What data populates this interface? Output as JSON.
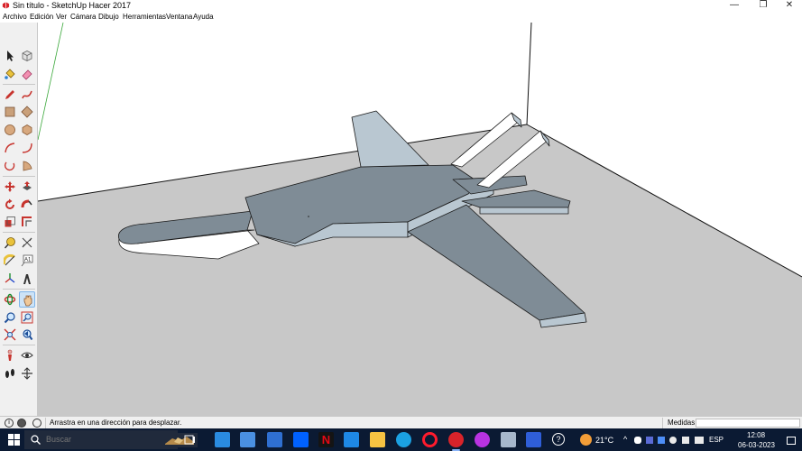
{
  "window": {
    "title": "Sin título - SketchUp Hacer 2017",
    "app_icon": "sketchup-logo-icon",
    "controls": [
      "minimize-icon",
      "maximize-icon",
      "close-icon"
    ],
    "minimize_glyph": "—",
    "maximize_glyph": "❐",
    "close_glyph": "✕"
  },
  "menubar": {
    "items": [
      "Archivo",
      "Edición",
      "Ver",
      "Cámara",
      "Dibujo",
      "Herramientas",
      "Ventana",
      "Ayuda"
    ]
  },
  "toolbar": {
    "tools": [
      {
        "name": "select-tool",
        "icon": "arrow-cursor-icon"
      },
      {
        "name": "make-component-tool",
        "icon": "component-icon"
      },
      {
        "name": "paint-bucket-tool",
        "icon": "paint-bucket-icon"
      },
      {
        "name": "eraser-tool",
        "icon": "eraser-icon"
      },
      {
        "name": "line-tool",
        "icon": "pencil-icon"
      },
      {
        "name": "freehand-tool",
        "icon": "freehand-icon"
      },
      {
        "name": "rectangle-tool",
        "icon": "rectangle-icon"
      },
      {
        "name": "rotated-rectangle-tool",
        "icon": "rotated-rectangle-icon"
      },
      {
        "name": "circle-tool",
        "icon": "circle-icon"
      },
      {
        "name": "polygon-tool",
        "icon": "polygon-icon"
      },
      {
        "name": "arc-tool",
        "icon": "arc-icon"
      },
      {
        "name": "two-point-arc-tool",
        "icon": "two-point-arc-icon"
      },
      {
        "name": "three-point-arc-tool",
        "icon": "three-point-arc-icon"
      },
      {
        "name": "pie-tool",
        "icon": "pie-icon"
      },
      {
        "name": "move-tool",
        "icon": "move-arrows-icon"
      },
      {
        "name": "push-pull-tool",
        "icon": "push-pull-icon"
      },
      {
        "name": "rotate-tool",
        "icon": "rotate-icon"
      },
      {
        "name": "follow-me-tool",
        "icon": "follow-me-icon"
      },
      {
        "name": "scale-tool",
        "icon": "scale-icon"
      },
      {
        "name": "offset-tool",
        "icon": "offset-icon"
      },
      {
        "name": "tape-measure-tool",
        "icon": "tape-measure-icon"
      },
      {
        "name": "dimension-tool",
        "icon": "dimension-icon"
      },
      {
        "name": "protractor-tool",
        "icon": "protractor-icon"
      },
      {
        "name": "text-tool",
        "icon": "text-icon",
        "glyph": "A1"
      },
      {
        "name": "axes-tool",
        "icon": "axes-icon"
      },
      {
        "name": "3d-text-tool",
        "icon": "3d-text-icon"
      },
      {
        "name": "orbit-tool",
        "icon": "orbit-icon"
      },
      {
        "name": "pan-tool",
        "icon": "pan-hand-icon",
        "active": true
      },
      {
        "name": "zoom-tool",
        "icon": "magnifier-icon"
      },
      {
        "name": "zoom-window-tool",
        "icon": "zoom-window-icon"
      },
      {
        "name": "zoom-extents-tool",
        "icon": "zoom-extents-icon"
      },
      {
        "name": "previous-view-tool",
        "icon": "previous-view-icon"
      },
      {
        "name": "position-camera-tool",
        "icon": "position-camera-icon"
      },
      {
        "name": "look-around-tool",
        "icon": "eye-icon"
      },
      {
        "name": "walk-tool",
        "icon": "footprints-icon"
      },
      {
        "name": "section-plane-tool",
        "icon": "section-plane-icon"
      }
    ]
  },
  "viewport": {
    "background_color": "#ffffff",
    "ground_color": "#c8c8c8",
    "model_top_color": "#7f8c96",
    "model_side_color": "#b9c7d1",
    "model_white_color": "#ffffff"
  },
  "statusbar": {
    "icons": [
      "info-icon",
      "geo-location-icon",
      "credits-icon"
    ],
    "message": "Arrastra en una dirección para desplazar.",
    "measurements_label": "Medidas",
    "measurements_value": ""
  },
  "taskbar": {
    "search_placeholder": "Buscar",
    "apps": [
      {
        "name": "task-view-icon",
        "color": "#ffffff"
      },
      {
        "name": "store-icon",
        "color": "#2a8be0"
      },
      {
        "name": "photos-icon",
        "color": "#4a90e2"
      },
      {
        "name": "mail-icon",
        "color": "#2f6fd1"
      },
      {
        "name": "dropbox-icon",
        "color": "#0061ff"
      },
      {
        "name": "netflix-icon",
        "color": "#e50914"
      },
      {
        "name": "solitaire-icon",
        "color": "#1e88e5"
      },
      {
        "name": "file-explorer-icon",
        "color": "#f5c242"
      },
      {
        "name": "edge-icon",
        "color": "#1ba1e2"
      },
      {
        "name": "opera-icon",
        "color": "#ff1b2d"
      },
      {
        "name": "sketchup-taskbar-icon",
        "color": "#d8232a",
        "active": true
      },
      {
        "name": "firefox-dev-icon",
        "color": "#b833e1"
      },
      {
        "name": "files-icon",
        "color": "#a6b7cc"
      },
      {
        "name": "app-launcher-icon",
        "color": "#2f5ed8"
      }
    ],
    "help_icon": "help-icon",
    "weather_temp": "21°C",
    "tray_icons": [
      "chevron-up-icon",
      "onedrive-icon",
      "teams-icon",
      "dropbox-tray-icon",
      "network-icon",
      "volume-icon",
      "battery-icon"
    ],
    "language": "ESP",
    "clock_time": "12:08",
    "clock_date": "06-03-2023",
    "notifications_icon": "notifications-icon"
  }
}
